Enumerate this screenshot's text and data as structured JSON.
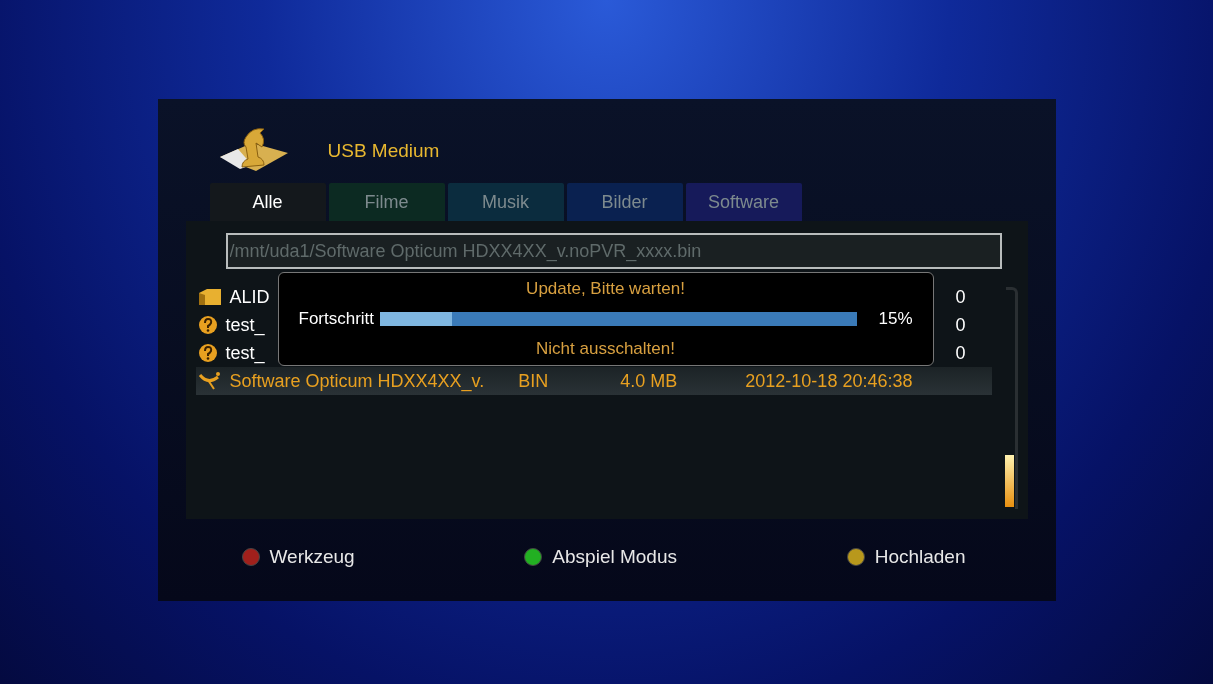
{
  "header": {
    "title": "USB Medium"
  },
  "tabs": [
    {
      "label": "Alle",
      "selected": true,
      "color": "#14181c"
    },
    {
      "label": "Filme",
      "selected": false,
      "color": "#0c2a22"
    },
    {
      "label": "Musik",
      "selected": false,
      "color": "#0b2c3e"
    },
    {
      "label": "Bilder",
      "selected": false,
      "color": "#0a2150"
    },
    {
      "label": "Software",
      "selected": false,
      "color": "#161a5a"
    }
  ],
  "path": {
    "value": "/mnt/uda1/Software Opticum HDXX4XX_v.noPVR_xxxx.bin"
  },
  "files": [
    {
      "kind": "folder",
      "name": "ALID",
      "last": "0",
      "selected": false
    },
    {
      "kind": "unknown",
      "name": "test_",
      "last": "0",
      "selected": false
    },
    {
      "kind": "unknown",
      "name": "test_",
      "last": "0",
      "selected": false
    },
    {
      "kind": "software",
      "name": "Software Opticum HDXX4XX_v.",
      "type": "BIN",
      "size": "4.0 MB",
      "date": "2012-10-18 20:46:38",
      "selected": true
    }
  ],
  "dialog": {
    "title": "Update, Bitte warten!",
    "label": "Fortschritt",
    "level": 0.15,
    "reading": "15%",
    "note": "Nicht ausschalten!"
  },
  "legend": [
    {
      "label": "Werkzeug",
      "color": "#a0201c"
    },
    {
      "label": "Abspiel Modus",
      "color": "#22b022"
    },
    {
      "label": "Hochladen",
      "color": "#b8981c"
    }
  ]
}
